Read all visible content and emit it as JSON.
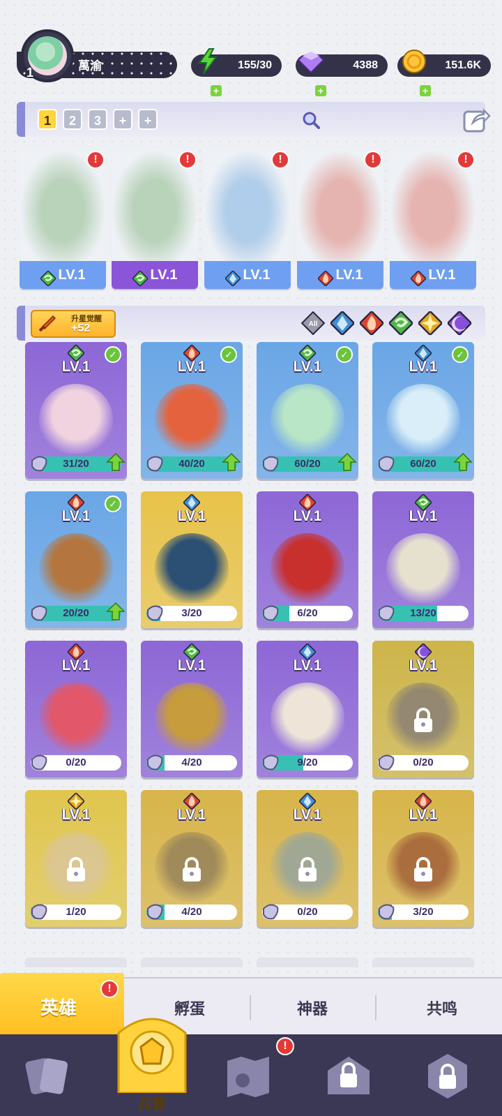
{
  "player": {
    "level": "1",
    "name": "萬渝"
  },
  "resources": {
    "energy": "155/30",
    "gems": "4388",
    "gold": "151.6K"
  },
  "team_tabs": [
    {
      "label": "1",
      "active": true
    },
    {
      "label": "2"
    },
    {
      "label": "3"
    },
    {
      "label": "+"
    },
    {
      "label": "+"
    }
  ],
  "deployed": [
    {
      "element": "wind",
      "level": "LV.1",
      "color": "#5ba04a",
      "bar": "#6e9ff0"
    },
    {
      "element": "wind",
      "level": "LV.1",
      "color": "#5ba04a",
      "bar": "#8a55d8"
    },
    {
      "element": "ice",
      "level": "LV.1",
      "color": "#3f8fd8",
      "bar": "#6e9ff0"
    },
    {
      "element": "fire",
      "level": "LV.1",
      "color": "#e0452e",
      "bar": "#6e9ff0"
    },
    {
      "element": "fire",
      "level": "LV.1",
      "color": "#e0452e",
      "bar": "#6e9ff0"
    }
  ],
  "star_awaken": {
    "title": "升星觉醒",
    "value": "+52"
  },
  "filters": [
    "All",
    "ice",
    "fire",
    "wind",
    "light",
    "dark"
  ],
  "heroes": [
    {
      "level": "LV.1",
      "element": "wind",
      "progress": "31/20",
      "ratio": 1,
      "check": true,
      "up": true,
      "bg": "#8d67d6",
      "art": "#f1d2df",
      "locked": false
    },
    {
      "level": "LV.1",
      "element": "fire",
      "progress": "40/20",
      "ratio": 1,
      "check": true,
      "up": true,
      "bg": "#6aa6e6",
      "art": "#e5623e",
      "locked": false
    },
    {
      "level": "LV.1",
      "element": "wind",
      "progress": "60/20",
      "ratio": 1,
      "check": true,
      "up": true,
      "bg": "#6aa6e6",
      "art": "#b9e6c6",
      "locked": false
    },
    {
      "level": "LV.1",
      "element": "ice",
      "progress": "60/20",
      "ratio": 1,
      "check": true,
      "up": true,
      "bg": "#6aa6e6",
      "art": "#d9eef8",
      "locked": false
    },
    {
      "level": "LV.1",
      "element": "fire",
      "progress": "20/20",
      "ratio": 1,
      "check": true,
      "up": true,
      "bg": "#6aa6e6",
      "art": "#b4763e",
      "locked": false
    },
    {
      "level": "LV.1",
      "element": "ice",
      "progress": "3/20",
      "ratio": 0.15,
      "check": false,
      "up": false,
      "bg": "#e8c34a",
      "art": "#2c4f74",
      "locked": false
    },
    {
      "level": "LV.1",
      "element": "fire",
      "progress": "6/20",
      "ratio": 0.3,
      "check": false,
      "up": false,
      "bg": "#8d67d6",
      "art": "#c8302e",
      "locked": false
    },
    {
      "level": "LV.1",
      "element": "wind",
      "progress": "13/20",
      "ratio": 0.65,
      "check": false,
      "up": false,
      "bg": "#8d67d6",
      "art": "#e6e1cf",
      "locked": false
    },
    {
      "level": "LV.1",
      "element": "fire",
      "progress": "0/20",
      "ratio": 0,
      "check": false,
      "up": false,
      "bg": "#8d67d6",
      "art": "#e2576a",
      "locked": false
    },
    {
      "level": "LV.1",
      "element": "wind",
      "progress": "4/20",
      "ratio": 0.2,
      "check": false,
      "up": false,
      "bg": "#8d67d6",
      "art": "#c79c3c",
      "locked": false
    },
    {
      "level": "LV.1",
      "element": "ice",
      "progress": "9/20",
      "ratio": 0.45,
      "check": false,
      "up": false,
      "bg": "#8d67d6",
      "art": "#eee5d8",
      "locked": false
    },
    {
      "level": "LV.1",
      "element": "dark",
      "progress": "0/20",
      "ratio": 0,
      "check": false,
      "up": false,
      "bg": "#cdb54a",
      "art": "#6b6680",
      "locked": true
    },
    {
      "level": "LV.1",
      "element": "light",
      "progress": "1/20",
      "ratio": 0.05,
      "check": false,
      "up": false,
      "bg": "#e0c64e",
      "art": "#d7c3b3",
      "locked": true
    },
    {
      "level": "LV.1",
      "element": "fire",
      "progress": "4/20",
      "ratio": 0.2,
      "check": false,
      "up": false,
      "bg": "#d8b54a",
      "art": "#7a6a5a",
      "locked": true
    },
    {
      "level": "LV.1",
      "element": "ice",
      "progress": "0/20",
      "ratio": 0,
      "check": false,
      "up": false,
      "bg": "#d8b54a",
      "art": "#7a9bb8",
      "locked": true
    },
    {
      "level": "LV.1",
      "element": "fire",
      "progress": "3/20",
      "ratio": 0.15,
      "check": false,
      "up": false,
      "bg": "#d8b54a",
      "art": "#8a3a2a",
      "locked": true
    }
  ],
  "subtabs": {
    "hero": "英雄",
    "egg": "孵蛋",
    "artifact": "神器",
    "resonance": "共鸣"
  },
  "nav": {
    "barracks": "兵营"
  },
  "colors": {
    "accent": "#ffc832",
    "alert": "#e53939",
    "nav": "#3b3856"
  }
}
